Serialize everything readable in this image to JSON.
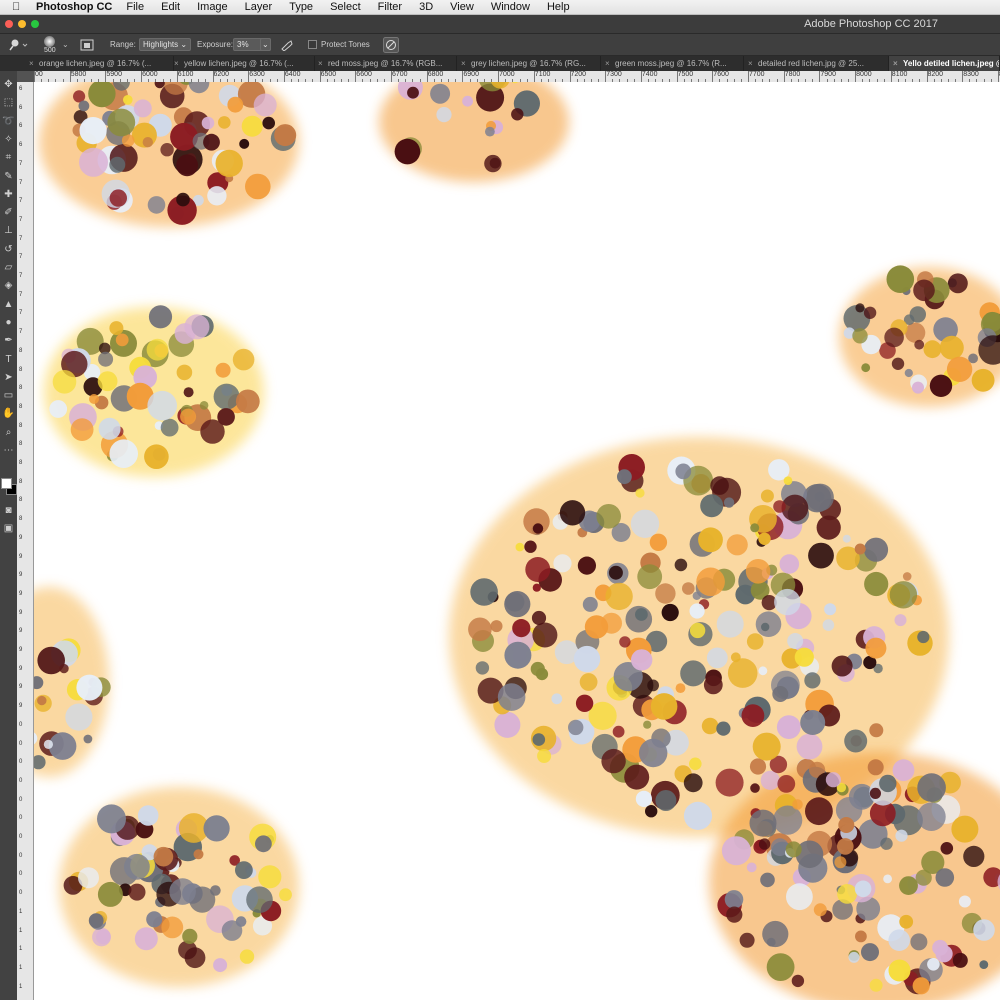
{
  "menubar": {
    "app_name": "Photoshop CC",
    "items": [
      "File",
      "Edit",
      "Image",
      "Layer",
      "Type",
      "Select",
      "Filter",
      "3D",
      "View",
      "Window",
      "Help"
    ]
  },
  "window": {
    "title": "Adobe Photoshop CC 2017"
  },
  "options_bar": {
    "brush_size": "500",
    "range_label": "Range:",
    "range_value": "Highlights",
    "exposure_label": "Exposure:",
    "exposure_value": "3%",
    "protect_tones_label": "Protect Tones"
  },
  "tabs": [
    {
      "label": "orange lichen.jpeg @ 16.7% (..."
    },
    {
      "label": "yellow lichen.jpeg @ 16.7% (..."
    },
    {
      "label": "red moss.jpeg @ 16.7% (RGB..."
    },
    {
      "label": "grey lichen.jpeg @ 16.7% (RG..."
    },
    {
      "label": "green moss.jpeg @ 16.7% (R..."
    },
    {
      "label": "detailed red lichen.jpg @ 25..."
    },
    {
      "label": "Yello detiled lichen.jpeg @ 16..."
    }
  ],
  "ruler_top": [
    "00",
    "5800",
    "5900",
    "6000",
    "6100",
    "6200",
    "6300",
    "6400",
    "6500",
    "6600",
    "6700",
    "6800",
    "6900",
    "7000",
    "7100",
    "7200",
    "7300",
    "7400",
    "7500",
    "7600",
    "7700",
    "7800",
    "7900",
    "8000",
    "8100",
    "8200",
    "8300",
    "8400"
  ],
  "ruler_left": [
    "6",
    "6",
    "6",
    "6",
    "7",
    "7",
    "7",
    "7",
    "7",
    "7",
    "7",
    "7",
    "7",
    "7",
    "8",
    "8",
    "8",
    "8",
    "8",
    "8",
    "8",
    "8",
    "8",
    "8",
    "9",
    "9",
    "9",
    "9",
    "9",
    "9",
    "9",
    "9",
    "9",
    "9",
    "0",
    "0",
    "0",
    "0",
    "0",
    "0",
    "0",
    "0",
    "0",
    "0",
    "1",
    "1",
    "1",
    "1",
    "1"
  ],
  "tools": [
    "move-icon",
    "marquee-icon",
    "lasso-icon",
    "magic-wand-icon",
    "crop-icon",
    "eyedropper-icon",
    "healing-icon",
    "brush-icon",
    "stamp-icon",
    "history-brush-icon",
    "eraser-icon",
    "bucket-icon",
    "blur-icon",
    "dodge-icon",
    "pen-icon",
    "type-icon",
    "path-select-icon",
    "rectangle-icon",
    "hand-icon",
    "zoom-icon",
    "more-icon"
  ],
  "colors": {
    "foreground": "#ffffff",
    "background": "#000000"
  }
}
